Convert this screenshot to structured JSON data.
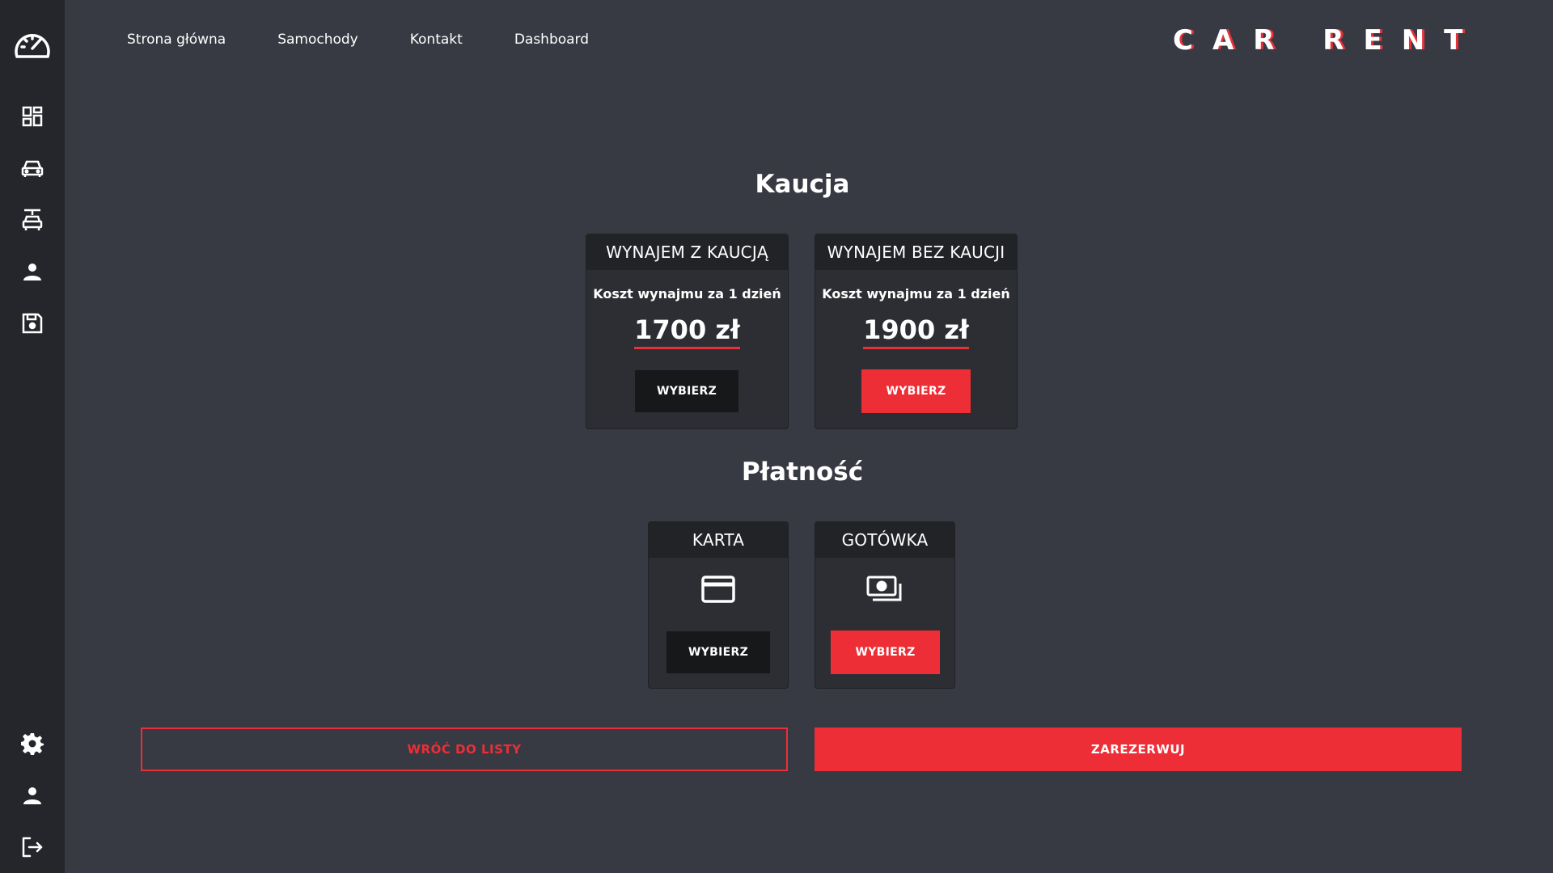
{
  "sidebar": {
    "top_icons": [
      "speedometer-icon",
      "dashboard-grid-icon",
      "car-icon",
      "car-rental-icon",
      "user-icon",
      "save-icon"
    ],
    "bottom_icons": [
      "gear-icon",
      "user-icon",
      "logout-icon"
    ]
  },
  "nav": {
    "items": [
      {
        "label": "Strona główna"
      },
      {
        "label": "Samochody"
      },
      {
        "label": "Kontakt"
      },
      {
        "label": "Dashboard"
      }
    ]
  },
  "brand": {
    "logo_text": "CAR RENT",
    "accent": "#ee2e36"
  },
  "deposit": {
    "title": "Kaucja",
    "options": [
      {
        "header": "WYNAJEM Z KAUCJĄ",
        "subtitle": "Koszt wynajmu za 1 dzień",
        "price": "1700 zł",
        "button": "WYBIERZ",
        "selected": false
      },
      {
        "header": "WYNAJEM BEZ KAUCJI",
        "subtitle": "Koszt wynajmu za 1 dzień",
        "price": "1900 zł",
        "button": "WYBIERZ",
        "selected": true
      }
    ]
  },
  "payment": {
    "title": "Płatność",
    "options": [
      {
        "header": "KARTA",
        "icon": "credit-card-icon",
        "button": "WYBIERZ",
        "selected": false
      },
      {
        "header": "GOTÓWKA",
        "icon": "cash-icon",
        "button": "WYBIERZ",
        "selected": true
      }
    ]
  },
  "actions": {
    "back": "WRÓĆ DO LISTY",
    "reserve": "ZAREZERWUJ"
  },
  "colors": {
    "background": "#373a43",
    "sidebar": "#24262b",
    "card": "#2c2e33",
    "card_header": "#222326",
    "button_dark": "#17181a",
    "accent": "#ee2e36"
  }
}
